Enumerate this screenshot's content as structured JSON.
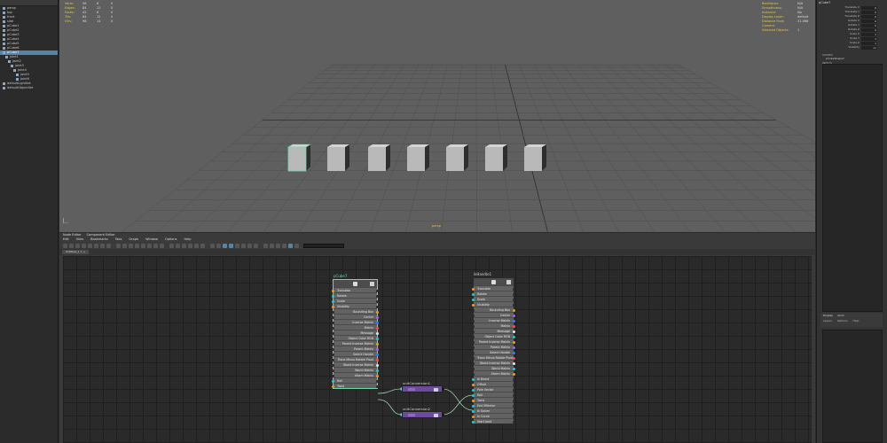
{
  "outliner": {
    "items": [
      {
        "label": "persp",
        "indent": 0
      },
      {
        "label": "top",
        "indent": 0
      },
      {
        "label": "front",
        "indent": 0
      },
      {
        "label": "side",
        "indent": 0
      },
      {
        "label": "pCube1",
        "indent": 0
      },
      {
        "label": "pCube2",
        "indent": 0
      },
      {
        "label": "pCube3",
        "indent": 0
      },
      {
        "label": "pCube4",
        "indent": 0
      },
      {
        "label": "pCube5",
        "indent": 0
      },
      {
        "label": "pCube6",
        "indent": 0
      },
      {
        "label": "pCube7",
        "indent": 0,
        "selected": true
      },
      {
        "label": "joint1",
        "indent": 1
      },
      {
        "label": "joint2",
        "indent": 2
      },
      {
        "label": "joint3",
        "indent": 3
      },
      {
        "label": "joint4",
        "indent": 4
      },
      {
        "label": "joint5",
        "indent": 5
      },
      {
        "label": "joint6",
        "indent": 5
      },
      {
        "label": "defaultLightSet",
        "indent": 0
      },
      {
        "label": "defaultObjectSet",
        "indent": 0
      }
    ]
  },
  "viewport": {
    "hud_left": [
      {
        "label": "Verts:",
        "a": "56",
        "b": "8",
        "c": "0"
      },
      {
        "label": "Edges:",
        "a": "84",
        "b": "12",
        "c": "0"
      },
      {
        "label": "Faces:",
        "a": "42",
        "b": "6",
        "c": "0"
      },
      {
        "label": "Tris:",
        "a": "84",
        "b": "12",
        "c": "0"
      },
      {
        "label": "UVs:",
        "a": "98",
        "b": "14",
        "c": "0"
      }
    ],
    "hud_right": [
      {
        "label": "Backfaces:",
        "v": "N/A"
      },
      {
        "label": "Smoothness:",
        "v": "N/A"
      },
      {
        "label": "Instance:",
        "v": "No"
      },
      {
        "label": "Display Layer:",
        "v": "default"
      },
      {
        "label": "Distance From Camera:",
        "v": "31.066"
      },
      {
        "label": "Selected Objects:",
        "v": "1"
      }
    ],
    "camera_label": "persp",
    "cube_count": 7
  },
  "channel_box": {
    "object_name": "pCube7",
    "attrs": [
      {
        "label": "Translate X",
        "val": "0"
      },
      {
        "label": "Translate Y",
        "val": "0"
      },
      {
        "label": "Translate Z",
        "val": "0"
      },
      {
        "label": "Rotate X",
        "val": "0"
      },
      {
        "label": "Rotate Y",
        "val": "0"
      },
      {
        "label": "Rotate Z",
        "val": "0"
      },
      {
        "label": "Scale X",
        "val": "1"
      },
      {
        "label": "Scale Y",
        "val": "1"
      },
      {
        "label": "Scale Z",
        "val": "1"
      },
      {
        "label": "Visibility",
        "val": "on"
      }
    ],
    "shapes_label": "SHAPES",
    "shape_name": "pCubeShape7",
    "inputs_label": "INPUTS",
    "input_name": "ikRPsolver (ikHandle1)(ikRPsolver)",
    "layer_tabs": [
      "Display",
      "Anim"
    ],
    "layer_menu": [
      "Layers",
      "Options",
      "Help"
    ]
  },
  "node_editor": {
    "panel_tabs": [
      "Node Editor",
      "Component Editor"
    ],
    "menu": [
      "Edit",
      "View",
      "Bookmarks",
      "Tabs",
      "Graph",
      "Window",
      "Options",
      "Help"
    ],
    "tab_label": "Untitled_1  ×  +",
    "nodes": {
      "pCube7": {
        "title": "pCube7",
        "attrs": [
          {
            "label": "Translate",
            "align": "l"
          },
          {
            "label": "Rotate",
            "align": "l"
          },
          {
            "label": "Scale",
            "align": "l"
          },
          {
            "label": "Visibility",
            "align": "l"
          },
          {
            "label": "Bounding Box",
            "align": "r"
          },
          {
            "label": "Center",
            "align": "r"
          },
          {
            "label": "Inverse Matrix",
            "align": "r"
          },
          {
            "label": "Matrix",
            "align": "r"
          },
          {
            "label": "Message",
            "align": "r"
          },
          {
            "label": "Object Color RGB",
            "align": "r"
          },
          {
            "label": "Parent Inverse Matrix",
            "align": "r"
          },
          {
            "label": "Parent Matrix",
            "align": "r"
          },
          {
            "label": "Select Handle",
            "align": "r"
          },
          {
            "label": "Trans Minus Rotate Pivot",
            "align": "r"
          },
          {
            "label": "World Inverse Matrix",
            "align": "r"
          },
          {
            "label": "World Matrix",
            "align": "r"
          },
          {
            "label": "Xform Matrix",
            "align": "r"
          },
          {
            "label": "Roll",
            "align": "l"
          },
          {
            "label": "Twist",
            "align": "l"
          }
        ]
      },
      "ikHandle1": {
        "title": "ikHandle1",
        "attrs": [
          {
            "label": "Translate",
            "align": "l"
          },
          {
            "label": "Rotate",
            "align": "l"
          },
          {
            "label": "Scale",
            "align": "l"
          },
          {
            "label": "Visibility",
            "align": "l"
          },
          {
            "label": "Bounding Box",
            "align": "r"
          },
          {
            "label": "Center",
            "align": "r"
          },
          {
            "label": "Inverse Matrix",
            "align": "r"
          },
          {
            "label": "Matrix",
            "align": "r"
          },
          {
            "label": "Message",
            "align": "r"
          },
          {
            "label": "Object Color RGB",
            "align": "r"
          },
          {
            "label": "Parent Inverse Matrix",
            "align": "r"
          },
          {
            "label": "Parent Matrix",
            "align": "r"
          },
          {
            "label": "Select Handle",
            "align": "r"
          },
          {
            "label": "Trans Minus Rotate Pivot",
            "align": "r"
          },
          {
            "label": "World Inverse Matrix",
            "align": "r"
          },
          {
            "label": "World Matrix",
            "align": "r"
          },
          {
            "label": "Xform Matrix",
            "align": "r"
          },
          {
            "label": "Ik Blend",
            "align": "l"
          },
          {
            "label": "Offset",
            "align": "l"
          },
          {
            "label": "Pole Vector",
            "align": "l"
          },
          {
            "label": "Roll",
            "align": "l"
          },
          {
            "label": "Twist",
            "align": "l"
          },
          {
            "label": "End Effector",
            "align": "l"
          },
          {
            "label": "Ik Solver",
            "align": "l"
          },
          {
            "label": "In Curve",
            "align": "l"
          },
          {
            "label": "Start Joint",
            "align": "l"
          }
        ]
      },
      "unitConversion1": {
        "title": "unitConversion1"
      },
      "unitConversion2": {
        "title": "unitConversion2"
      }
    }
  },
  "colors": {
    "selection_blue": "#5285a6",
    "selected_node_outline": "#6fd7a8",
    "hud_yellow": "#e7c93a",
    "conversion_purple": "#6d4b9c"
  }
}
